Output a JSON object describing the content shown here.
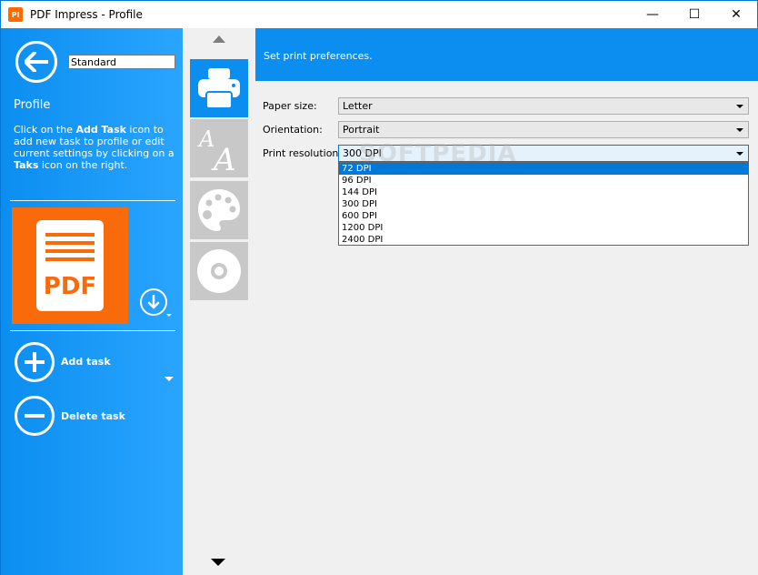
{
  "window": {
    "title": "PDF Impress - Profile",
    "icon_glyph": "PI",
    "minimize_glyph": "—",
    "maximize_glyph": "☐",
    "close_glyph": "✕"
  },
  "sidebar": {
    "profile_name": "Standard",
    "section_title": "Profile",
    "help": {
      "part1": "Click on the ",
      "bold1": "Add Task",
      "part2": " icon to add new task to profile or edit current settings by clicking on a ",
      "bold2": "Taks",
      "part3": " icon on the right."
    },
    "pdf_tile_label": "PDF",
    "add_task_label": "Add task",
    "delete_task_label": "Delete task"
  },
  "categories": [
    {
      "name": "print",
      "icon": "printer-icon",
      "active": true
    },
    {
      "name": "fonts",
      "icon": "font-icon",
      "active": false
    },
    {
      "name": "colors",
      "icon": "palette-icon",
      "active": false
    },
    {
      "name": "media",
      "icon": "disc-icon",
      "active": false
    }
  ],
  "main": {
    "banner_text": "Set print preferences.",
    "paper_size": {
      "label": "Paper size:",
      "value": "Letter"
    },
    "orientation": {
      "label": "Orientation:",
      "value": "Portrait"
    },
    "print_resolution": {
      "label": "Print resolution:",
      "value": "300 DPI",
      "options": [
        "72 DPI",
        "96 DPI",
        "144 DPI",
        "300 DPI",
        "600 DPI",
        "1200 DPI",
        "2400 DPI"
      ],
      "highlighted": "72 DPI"
    }
  },
  "watermark": "SOFTPEDIA",
  "colors": {
    "accent_blue": "#0b8ef0",
    "pdf_orange": "#f96a0a",
    "tile_gray": "#c8c8c8"
  }
}
